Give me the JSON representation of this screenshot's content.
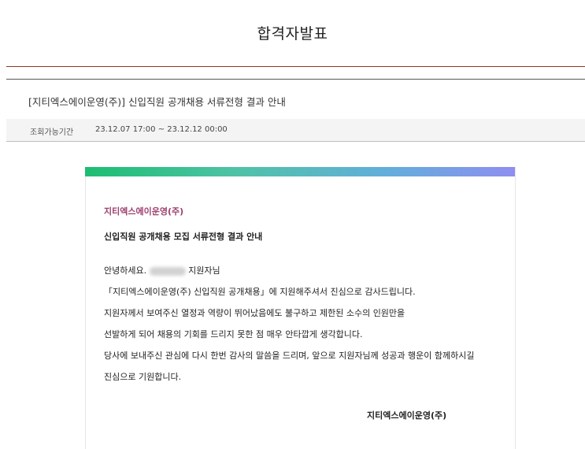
{
  "page": {
    "title": "합격자발표"
  },
  "notice": {
    "title": "[지티엑스에이운영(주)] 신입직원 공개채용 서류전형 결과 안내",
    "period_label": "조회가능기간",
    "period_value": "23.12.07 17:00 ~ 23.12.12 00:00"
  },
  "letter": {
    "company": "지티엑스에이운영(주)",
    "subject": "신입직원 공개채용 모집 서류전형 결과 안내",
    "greeting_prefix": "안녕하세요.",
    "greeting_suffix": "지원자님",
    "lines": [
      "「지티엑스에이운영(주) 신입직원 공개채용」에 지원해주셔서 진심으로 감사드립니다.",
      "지원자께서 보여주신 열정과 역량이 뛰어났음에도 불구하고 제한된 소수의 인원만을",
      "선발하게 되어 채용의 기회를 드리지 못한 점 매우 안타깝게 생각합니다.",
      "당사에 보내주신 관심에 다시 한번 감사의 말씀을 드리며, 앞으로 지원자님께 성공과 행운이 함께하시길",
      "진심으로 기원합니다."
    ],
    "signature": "지티엑스에이운영(주)"
  },
  "colors": {
    "company_accent": "#9c3f6e",
    "header_rule": "#8a3a24",
    "gradient": [
      "#1dbd72",
      "#62aedb",
      "#8f8ef0"
    ]
  }
}
